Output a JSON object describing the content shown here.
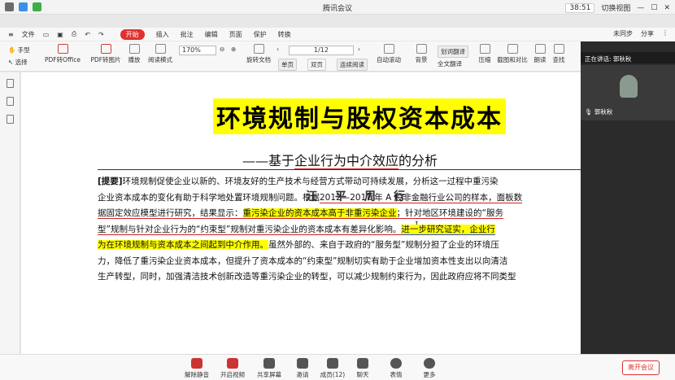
{
  "meeting": {
    "title": "腾讯会议",
    "timer": "38:51",
    "switch_view": "切换视图",
    "speaking_label": "正在讲话: 郭秋秋",
    "participant_name": "郭秋秋",
    "toolbar": {
      "mute": "解除静音",
      "video": "开启视频",
      "share": "共享屏幕",
      "invite": "邀请",
      "members": "成员(12)",
      "chat": "聊天",
      "reactions": "表情",
      "more": "更多",
      "leave": "离开会议"
    }
  },
  "wps": {
    "file_menu": "文件",
    "tabs": [
      "开始",
      "插入",
      "批注",
      "编辑",
      "页面",
      "保护",
      "转换"
    ],
    "sync": "未同步",
    "share": "分享",
    "ribbon": {
      "hand": "手型",
      "select": "选择",
      "pdf_office": "PDF转Office",
      "pdf_image": "PDF转图片",
      "play": "播放",
      "read_mode": "阅读模式",
      "zoom": "170%",
      "page": "1/12",
      "rotate": "旋转文档",
      "single": "单页",
      "double": "双页",
      "continuous": "连续阅读",
      "autoscroll": "自动滚动",
      "background": "背景",
      "translate": "划词翻译",
      "full_translate": "全文翻译",
      "compress": "压缩",
      "screenshot": "截图和对比",
      "tts": "朗读",
      "find": "查找"
    }
  },
  "document": {
    "title": "环境规制与股权资本成本",
    "subtitle_prefix": "——基于",
    "subtitle_underlined": "企业行为中介效应",
    "subtitle_suffix": "的分析",
    "author": "汪平周行",
    "abstract_lines": [
      {
        "parts": [
          {
            "t": "[提要]",
            "s": "b"
          },
          {
            "t": "环境规制促使企业以新的、环境友好的生产技术与经营方式带动可持续发展，分析这一过程中重污染"
          }
        ]
      },
      {
        "parts": [
          {
            "t": "企业资本成本的变化有助于科学地处置环境规制问题。根据"
          },
          {
            "t": "2012—2017 年 A 股非金融行业公司的样本，面板数",
            "s": "ul"
          }
        ]
      },
      {
        "parts": [
          {
            "t": "据固定效应模型进行研究，结果显示：",
            "s": "ul"
          },
          {
            "t": "重污染企业的资本成本高于非重污染企业",
            "s": "hl ul"
          },
          {
            "t": "；针对地区环境建设的“服务",
            "s": "ul"
          }
        ]
      },
      {
        "parts": [
          {
            "t": "型”规制与针对企业行为的“约束型”规制对重污染企业的资本成本有差异化影响。",
            "s": "ul"
          },
          {
            "t": "进一步研究证实，企业行",
            "s": "hl ulb"
          }
        ]
      },
      {
        "parts": [
          {
            "t": "为在环境规制与资本成本之间起到中介作用。",
            "s": "hl"
          },
          {
            "t": "虽然外部的、来自于政府的“服务型”规制分担了企业的环境压"
          }
        ]
      },
      {
        "parts": [
          {
            "t": "力，降低了重污染企业资本成本，但提升了资本成本的“约束型”规制切实有助于企业增加资本性支出以向清洁"
          }
        ]
      },
      {
        "parts": [
          {
            "t": "生产转型，同时，加强清洁技术创新改造等重污染企业的转型，可以减少规制约束行为，因此政府应将不同类型"
          }
        ]
      }
    ]
  }
}
